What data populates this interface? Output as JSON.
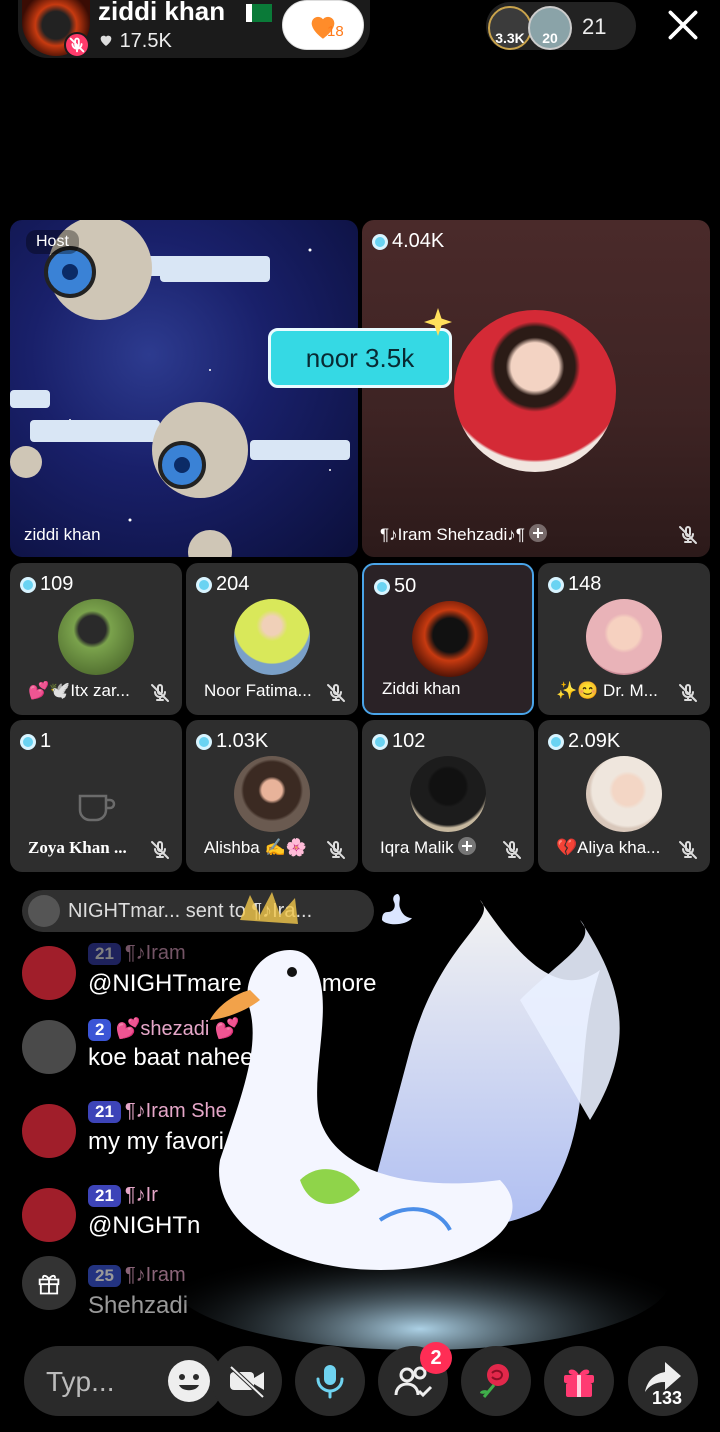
{
  "header": {
    "host_name": "ziddi khan",
    "likes": "17.5K",
    "follow_count": "18",
    "viewer1_count": "3.3K",
    "viewer2_count": "20",
    "viewer_total": "21"
  },
  "tiles": {
    "host": {
      "tag": "Host",
      "name": "ziddi khan"
    },
    "guest_main": {
      "count": "4.04K",
      "name": "¶♪Iram Shehzadi♪¶"
    },
    "badge": "noor 3.5k",
    "small": [
      {
        "count": "109",
        "name": "💕🕊️Itx zar..."
      },
      {
        "count": "204",
        "name": "Noor Fatima..."
      },
      {
        "count": "50",
        "name": "Ziddi khan"
      },
      {
        "count": "148",
        "name": "✨😊 Dr. M..."
      },
      {
        "count": "1",
        "name": "Zoya Khan ..."
      },
      {
        "count": "1.03K",
        "name": "Alishba ✍️🌸"
      },
      {
        "count": "102",
        "name": "Iqra Malik"
      },
      {
        "count": "2.09K",
        "name": "💔Aliya kha..."
      }
    ]
  },
  "chat": {
    "notify": "NIGHTmar... sent to ¶♪Ira...",
    "messages": [
      {
        "level": "21",
        "name": "¶♪Iram",
        "text": "@NIGHTmare ... one more"
      },
      {
        "level": "2",
        "name": "💕shezadi 💕",
        "text": "koe baat nahee"
      },
      {
        "level": "21",
        "name": "¶♪Iram She",
        "text": "my my favori"
      },
      {
        "level": "21",
        "name": "¶♪Ir",
        "text": "@NIGHTn"
      },
      {
        "level": "25",
        "name": "¶♪Iram",
        "text": "Shehzadi"
      }
    ]
  },
  "bottom": {
    "type_placeholder": "Typ...",
    "guests_badge": "2",
    "share_count": "133"
  },
  "colors": {
    "accent_cyan": "#35d9e4",
    "badge_red": "#ff2d55",
    "level_blue": "#3b55d6"
  }
}
